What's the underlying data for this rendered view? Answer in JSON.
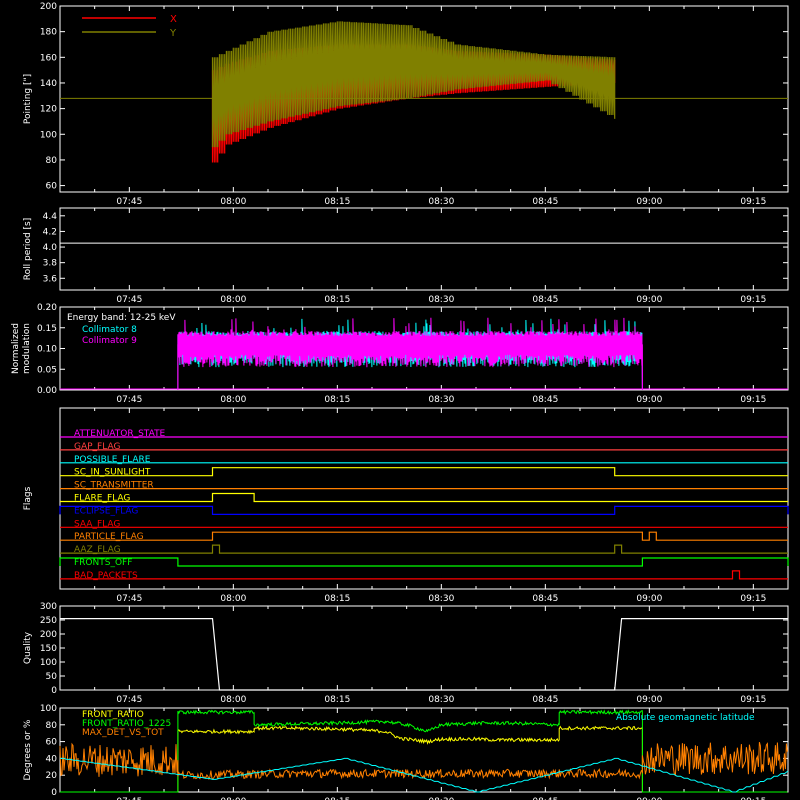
{
  "time_axis": {
    "start": "07:35",
    "end": "09:20",
    "tick_labels": [
      "07:45",
      "08:00",
      "08:15",
      "08:30",
      "08:45",
      "09:00",
      "09:15"
    ]
  },
  "chart_data": [
    {
      "id": "pointing",
      "type": "line",
      "title": "",
      "ylabel": "Pointing [\"]",
      "ylim": [
        55,
        200
      ],
      "yticks": [
        60,
        80,
        100,
        120,
        140,
        160,
        180,
        200
      ],
      "grid": false,
      "legend": "top-left",
      "series": [
        {
          "name": "X",
          "color": "#ff0000",
          "envelope": {
            "x": [
              "07:57",
              "07:59",
              "08:05",
              "08:15",
              "08:25",
              "08:32",
              "08:45",
              "08:55"
            ],
            "min": [
              78,
              92,
              105,
              120,
              128,
              132,
              137,
              140
            ],
            "max": [
              150,
              155,
              165,
              170,
              170,
              165,
              162,
              158
            ]
          }
        },
        {
          "name": "Y",
          "color": "#808000",
          "baseline": 128,
          "envelope": {
            "x": [
              "07:57",
              "07:59",
              "08:05",
              "08:15",
              "08:25",
              "08:32",
              "08:45",
              "08:55"
            ],
            "min": [
              90,
              100,
              110,
              122,
              128,
              135,
              142,
              112
            ],
            "max": [
              160,
              165,
              180,
              188,
              185,
              170,
              162,
              160
            ]
          }
        }
      ]
    },
    {
      "id": "roll",
      "type": "line",
      "ylabel": "Roll period [s]",
      "ylim": [
        3.45,
        4.5
      ],
      "yticks": [
        3.6,
        3.8,
        4.0,
        4.2,
        4.4
      ],
      "series": [
        {
          "name": "",
          "color": "#ffffff",
          "x": [
            "07:35",
            "09:20"
          ],
          "y": [
            4.05,
            4.05
          ]
        }
      ]
    },
    {
      "id": "modulation",
      "type": "bar",
      "ylabel": "Normalized modulation",
      "ylim": [
        0,
        0.2
      ],
      "yticks": [
        0.0,
        0.05,
        0.1,
        0.15,
        0.2
      ],
      "annotation": "Energy band: 12-25 keV",
      "active_interval": [
        "07:52",
        "08:59"
      ],
      "typical_range": [
        0.07,
        0.13
      ],
      "series": [
        {
          "name": "Collimator 8",
          "color": "#00ffff"
        },
        {
          "name": "Collimator 9",
          "color": "#ff00ff"
        }
      ]
    },
    {
      "id": "flags",
      "type": "step",
      "ylabel": "Flags",
      "series": [
        {
          "name": "ATTENUATOR_STATE",
          "color": "#ff00ff",
          "high": []
        },
        {
          "name": "GAP_FLAG",
          "color": "#ff4040",
          "high": []
        },
        {
          "name": "POSSIBLE_FLARE",
          "color": "#00ffff",
          "high": []
        },
        {
          "name": "SC_IN_SUNLIGHT",
          "color": "#ffff00",
          "high": [
            [
              "07:57",
              "08:55"
            ]
          ]
        },
        {
          "name": "SC_TRANSMITTER",
          "color": "#ff8000",
          "high": []
        },
        {
          "name": "FLARE_FLAG",
          "color": "#ffff00",
          "high": [
            [
              "07:57",
              "08:03"
            ]
          ]
        },
        {
          "name": "ECLIPSE_FLAG",
          "color": "#0000ff",
          "high": [
            [
              "07:35",
              "07:57"
            ],
            [
              "08:55",
              "09:20"
            ]
          ]
        },
        {
          "name": "SAA_FLAG",
          "color": "#ff0000",
          "high": []
        },
        {
          "name": "PARTICLE_FLAG",
          "color": "#ff8000",
          "high": [
            [
              "07:57",
              "08:59"
            ],
            [
              "09:00",
              "09:01"
            ]
          ]
        },
        {
          "name": "AAZ_FLAG",
          "color": "#808000",
          "high": [
            [
              "07:57",
              "07:58"
            ],
            [
              "08:55",
              "08:56"
            ]
          ]
        },
        {
          "name": "FRONTS_OFF",
          "color": "#00ff00",
          "high": [
            [
              "07:35",
              "07:52"
            ],
            [
              "08:59",
              "09:20"
            ]
          ]
        },
        {
          "name": "BAD_PACKETS",
          "color": "#ff0000",
          "high": [
            [
              "09:12",
              "09:13"
            ]
          ]
        }
      ]
    },
    {
      "id": "quality",
      "type": "line",
      "ylabel": "Quality",
      "ylim": [
        0,
        300
      ],
      "yticks": [
        0,
        50,
        100,
        150,
        200,
        250,
        300
      ],
      "series": [
        {
          "name": "",
          "color": "#ffffff",
          "x": [
            "07:35",
            "07:57",
            "07:58",
            "08:55",
            "08:56",
            "09:20"
          ],
          "y": [
            255,
            255,
            0,
            0,
            255,
            255
          ]
        }
      ]
    },
    {
      "id": "front_ratio",
      "type": "line",
      "ylabel": "Degrees or %",
      "ylim": [
        0,
        100
      ],
      "yticks": [
        0,
        20,
        40,
        60,
        80,
        100
      ],
      "series": [
        {
          "name": "FRONT_RATIO",
          "color": "#ffff00",
          "x": [
            "07:35",
            "07:52",
            "07:52",
            "08:03",
            "08:03",
            "08:06",
            "08:08",
            "08:15",
            "08:18",
            "08:22",
            "08:24",
            "08:28",
            "08:30",
            "08:35",
            "08:38",
            "08:45",
            "08:47",
            "08:47",
            "08:59",
            "08:59",
            "09:20"
          ],
          "y": [
            0,
            0,
            72,
            72,
            76,
            76,
            76,
            75,
            74,
            72,
            64,
            60,
            63,
            63,
            62,
            62,
            62,
            76,
            76,
            0,
            0
          ]
        },
        {
          "name": "FRONT_RATIO_1225",
          "color": "#00ff00",
          "x": [
            "07:35",
            "07:52",
            "07:52",
            "08:03",
            "08:03",
            "08:15",
            "08:22",
            "08:25",
            "08:28",
            "08:30",
            "08:35",
            "08:40",
            "08:47",
            "08:47",
            "08:59",
            "08:59",
            "09:20"
          ],
          "y": [
            0,
            0,
            95,
            95,
            80,
            82,
            84,
            80,
            72,
            80,
            82,
            82,
            80,
            95,
            95,
            0,
            0
          ]
        },
        {
          "name": "MAX_DET_VS_TOT",
          "color": "#ff8000",
          "x": [
            "07:35",
            "07:52",
            "07:52",
            "08:10",
            "08:30",
            "08:45",
            "08:59",
            "08:59",
            "09:20"
          ],
          "y": [
            38,
            38,
            20,
            22,
            22,
            22,
            22,
            40,
            40
          ]
        },
        {
          "name": "Absolute geomagnetic latitude",
          "color": "#00ffff",
          "x": [
            "07:35",
            "07:57",
            "08:16",
            "08:35",
            "08:55",
            "09:12",
            "09:20"
          ],
          "y": [
            40,
            15,
            40,
            0,
            40,
            0,
            25
          ]
        }
      ]
    }
  ]
}
